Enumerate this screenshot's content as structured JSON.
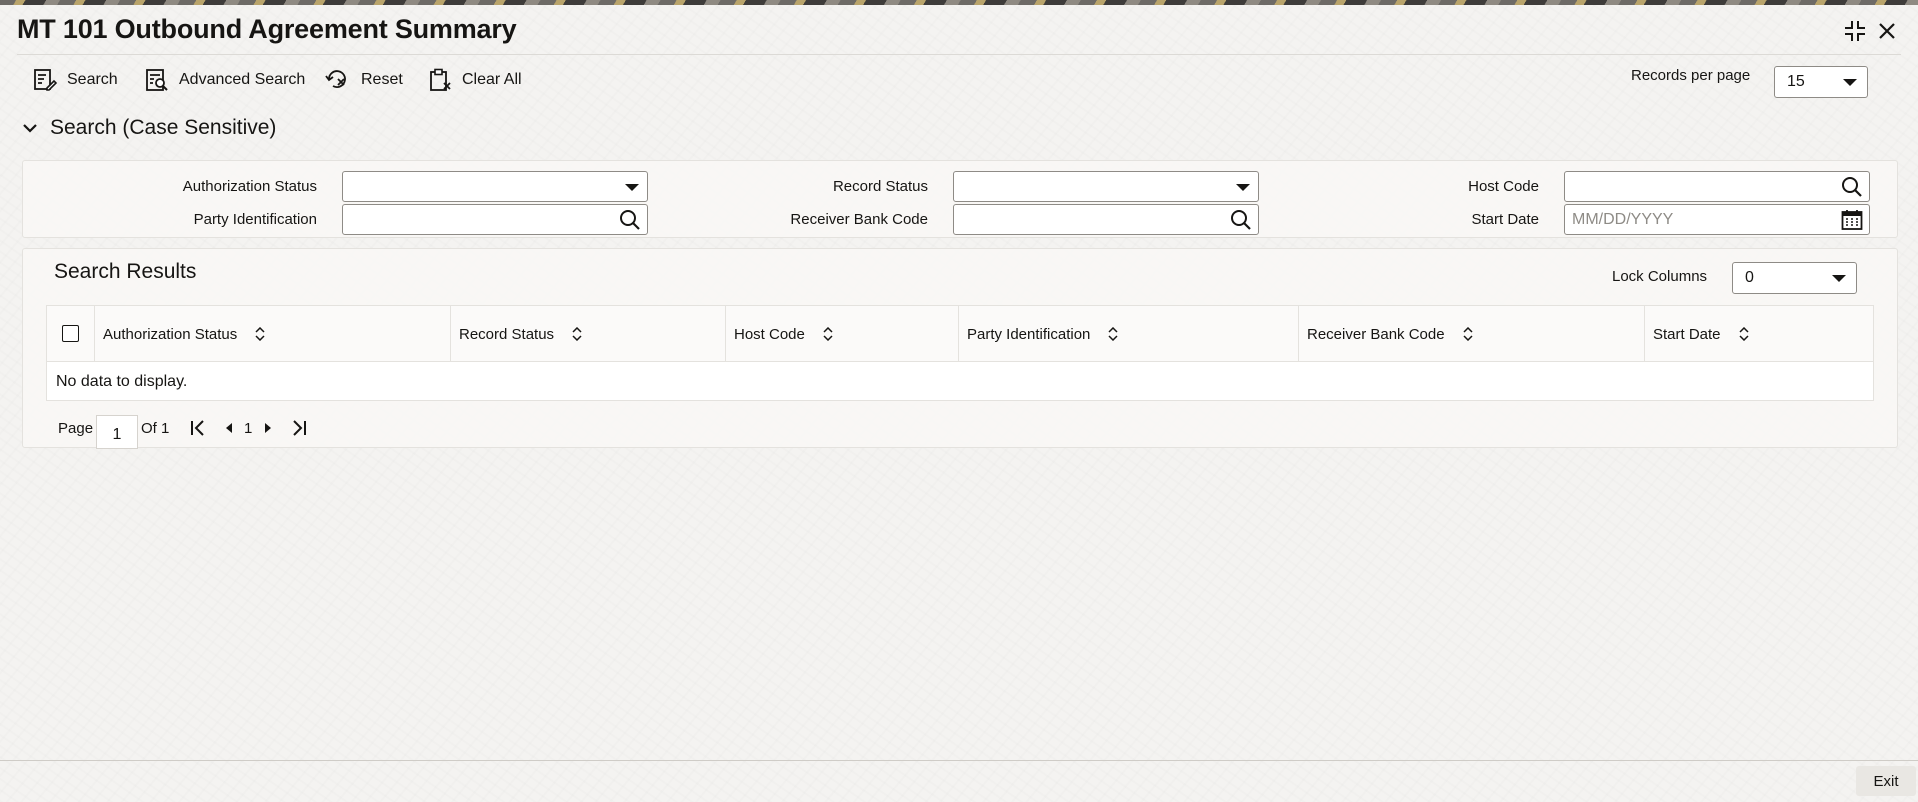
{
  "window": {
    "title": "MT 101 Outbound Agreement Summary"
  },
  "toolbar": {
    "search_label": "Search",
    "advanced_search_label": "Advanced Search",
    "reset_label": "Reset",
    "clear_all_label": "Clear All",
    "records_per_page_label": "Records per page",
    "records_per_page_value": "15"
  },
  "search_section": {
    "title": "Search (Case Sensitive)",
    "fields": {
      "authorization_status": {
        "label": "Authorization Status",
        "value": ""
      },
      "record_status": {
        "label": "Record Status",
        "value": ""
      },
      "host_code": {
        "label": "Host Code",
        "value": ""
      },
      "party_identification": {
        "label": "Party Identification",
        "value": ""
      },
      "receiver_bank_code": {
        "label": "Receiver Bank Code",
        "value": ""
      },
      "start_date": {
        "label": "Start Date",
        "value": "",
        "placeholder": "MM/DD/YYYY"
      }
    }
  },
  "results": {
    "title": "Search Results",
    "lock_columns_label": "Lock Columns",
    "lock_columns_value": "0",
    "columns": [
      "Authorization Status",
      "Record Status",
      "Host Code",
      "Party Identification",
      "Receiver Bank Code",
      "Start Date"
    ],
    "empty_message": "No data to display."
  },
  "pagination": {
    "page_label": "Page",
    "current_page": "1",
    "of_label": "Of 1",
    "page_number": "1"
  },
  "footer": {
    "exit_label": "Exit"
  },
  "icons": {
    "search": "search-icon",
    "calendar": "calendar-icon",
    "sort": "sort-icon"
  }
}
